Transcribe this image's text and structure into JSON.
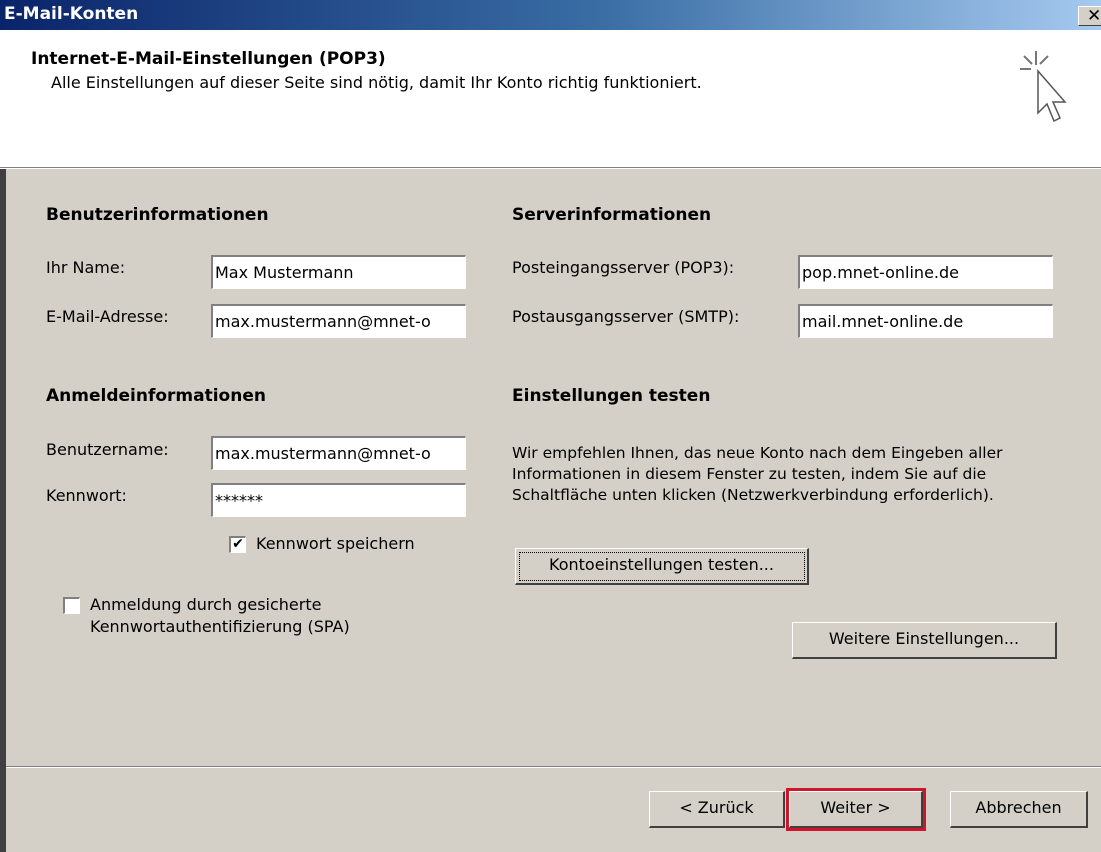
{
  "window": {
    "title": "E-Mail-Konten",
    "close": "✕"
  },
  "header": {
    "title": "Internet-E-Mail-Einstellungen (POP3)",
    "subtitle": "Alle Einstellungen auf dieser Seite sind nötig, damit Ihr Konto richtig funktioniert.",
    "icon": "wizard-cursor-icon"
  },
  "user_info": {
    "heading": "Benutzerinformationen",
    "name_label": "Ihr Name:",
    "name_value": "Max Mustermann",
    "email_label": "E-Mail-Adresse:",
    "email_value": "max.mustermann@mnet-o"
  },
  "login_info": {
    "heading": "Anmeldeinformationen",
    "username_label": "Benutzername:",
    "username_value": "max.mustermann@mnet-o",
    "password_label": "Kennwort:",
    "password_value": "******",
    "save_password_label": "Kennwort speichern",
    "save_password_checked": true,
    "spa_label_line1": "Anmeldung durch gesicherte",
    "spa_label_line2": "Kennwortauthentifizierung (SPA)",
    "spa_checked": false
  },
  "server_info": {
    "heading": "Serverinformationen",
    "incoming_label": "Posteingangsserver (POP3):",
    "incoming_value": "pop.mnet-online.de",
    "outgoing_label": "Postausgangsserver (SMTP):",
    "outgoing_value": "mail.mnet-online.de"
  },
  "test": {
    "heading": "Einstellungen testen",
    "description": "Wir empfehlen Ihnen, das neue Konto nach dem Eingeben aller Informationen in diesem Fenster zu testen, indem Sie auf die Schaltfläche unten klicken (Netzwerkverbindung erforderlich).",
    "test_button": "Kontoeinstellungen testen...",
    "more_settings_button": "Weitere Einstellungen..."
  },
  "footer": {
    "back_button": "< Zurück",
    "next_button": "Weiter >",
    "cancel_button": "Abbrechen",
    "highlight_color": "#d0142a"
  }
}
